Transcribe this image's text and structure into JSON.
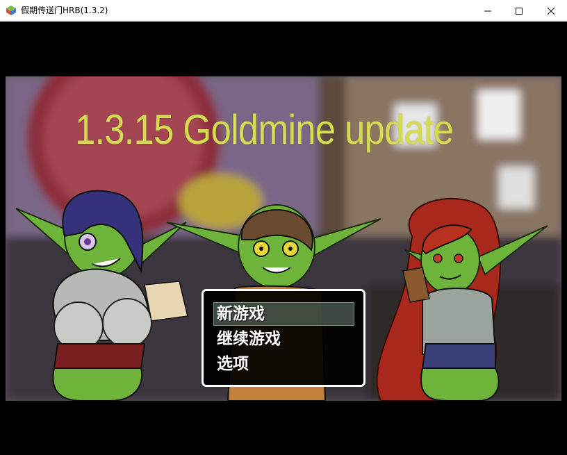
{
  "window": {
    "title": "假期传送门HRB(1.3.2)",
    "app_icon": "game-app-icon",
    "controls": [
      "minimize-icon",
      "maximize-icon",
      "close-icon"
    ]
  },
  "game": {
    "version_banner": "1.3.15 Goldmine update",
    "banner_color": "#d6dc52",
    "menu": {
      "items": [
        {
          "label": "新游戏",
          "selected": true
        },
        {
          "label": "继续游戏",
          "selected": false
        },
        {
          "label": "选项",
          "selected": false
        }
      ]
    },
    "characters": [
      "goblin-blue-hair",
      "goblin-brown-hair",
      "goblin-red-hair"
    ]
  },
  "colors": {
    "goblin_skin": "#6fb43a",
    "menu_bg": "#000000",
    "menu_border": "#ffffff"
  }
}
